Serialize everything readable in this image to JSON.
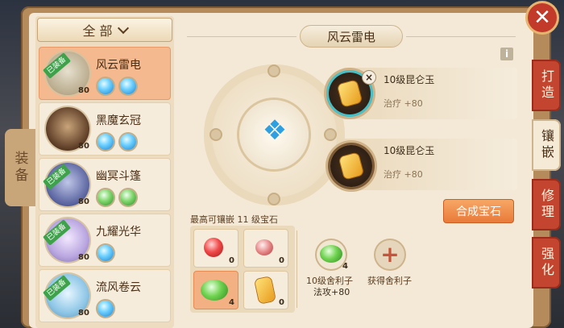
{
  "close_symbol": "✕",
  "left_tab": {
    "label": "装备"
  },
  "filter": {
    "label": "全 部"
  },
  "equipment": [
    {
      "name": "风云雷电",
      "level": "80",
      "equipped": "已装备",
      "icon": "fan-icon",
      "gems": [
        "blue",
        "blue"
      ]
    },
    {
      "name": "黑魔玄冠",
      "level": "80",
      "equipped": "",
      "icon": "helmet-icon",
      "gems": [
        "blue",
        "blue"
      ]
    },
    {
      "name": "幽冥斗篷",
      "level": "80",
      "equipped": "已装备",
      "icon": "cloak-icon",
      "gems": [
        "green",
        "green"
      ]
    },
    {
      "name": "九耀光华",
      "level": "80",
      "equipped": "已装备",
      "icon": "ornament-icon",
      "gems": [
        "blue"
      ]
    },
    {
      "name": "流风卷云",
      "level": "80",
      "equipped": "已装备",
      "icon": "belt-icon",
      "gems": [
        "blue"
      ]
    }
  ],
  "center": {
    "title": "风云雷电",
    "info_symbol": "i",
    "fan_symbol": "❖"
  },
  "sockets": [
    {
      "name": "10级昆仑玉",
      "attr": "治疗 +80",
      "remove": "×"
    },
    {
      "name": "10级昆仑玉",
      "attr": "治疗 +80"
    }
  ],
  "combine_button": "合成宝石",
  "right_tabs": [
    "打造",
    "镶嵌",
    "修理",
    "强化"
  ],
  "inventory": {
    "max_label": "最高可镶嵌 11 级宝石",
    "items": [
      {
        "icon": "red-gem-icon",
        "count": "0"
      },
      {
        "icon": "pink-gem-icon",
        "count": "0"
      },
      {
        "icon": "green-gem-icon",
        "count": "4"
      },
      {
        "icon": "yellow-gem-icon",
        "count": "0"
      }
    ]
  },
  "selected_gem": {
    "count": "4",
    "name": "10级舍利子",
    "attr": "法攻+80"
  },
  "obtain": {
    "symbol": "+",
    "label": "获得舍利子"
  },
  "colors": {
    "accent_red": "#c3452f",
    "combine_orange": "#e97a3a",
    "equipped_green": "#3da24a"
  }
}
